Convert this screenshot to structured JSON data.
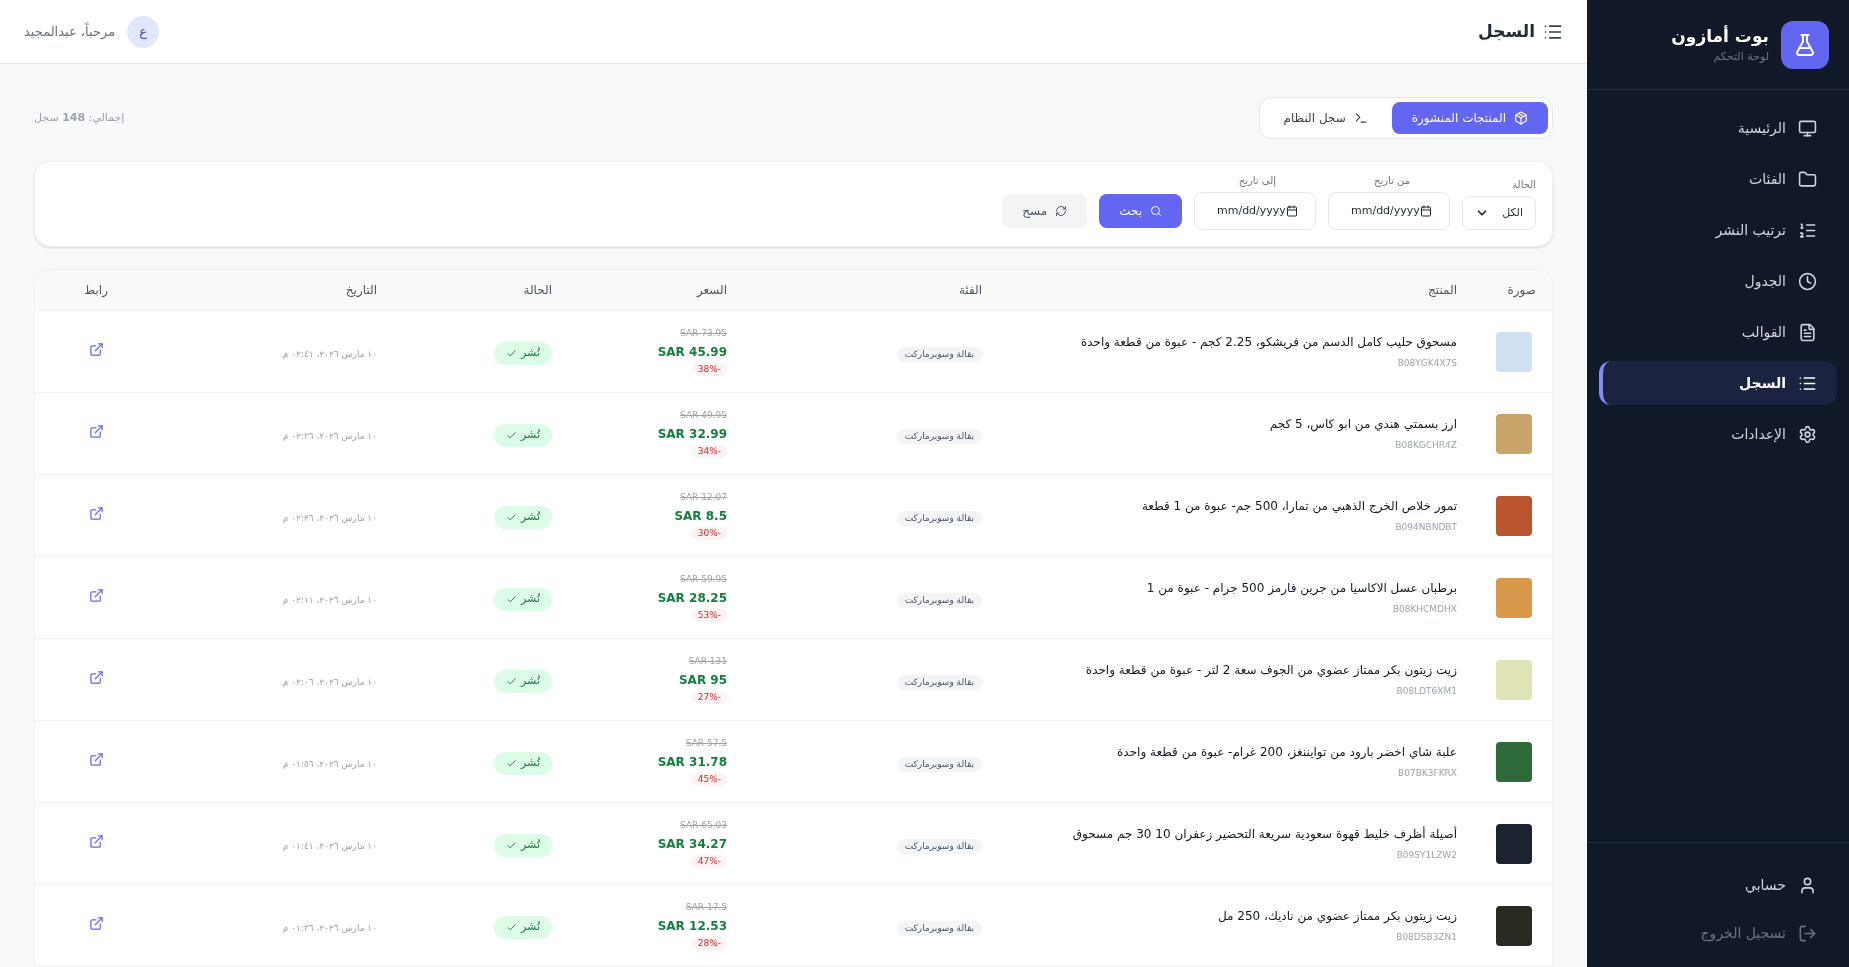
{
  "sidebar": {
    "brand": {
      "title": "بوت أمازون",
      "subtitle": "لوحة التحكم"
    },
    "items": [
      {
        "label": "الرئيسية",
        "selected": false
      },
      {
        "label": "الفئات",
        "selected": false
      },
      {
        "label": "ترتيب النشر",
        "selected": false
      },
      {
        "label": "الجدول",
        "selected": false
      },
      {
        "label": "القوالب",
        "selected": false
      },
      {
        "label": "السجل",
        "selected": true
      },
      {
        "label": "الإعدادات",
        "selected": false
      }
    ],
    "footer_items": [
      {
        "label": "حسابي"
      },
      {
        "label": "تسجيل الخروج"
      }
    ]
  },
  "header": {
    "title": "السجل",
    "avatar_initial": "ع",
    "greeting": "مرحباً، عبدالمجيد"
  },
  "tabs": [
    {
      "label": "المنتجات المنشورة",
      "selected": true
    },
    {
      "label": "سجل النظام",
      "selected": false
    }
  ],
  "total": "إجمالي: **148** سجل",
  "filters": {
    "status": {
      "label": "الحالة",
      "value": "الكل"
    },
    "from_date": {
      "label": "من تاريخ",
      "placeholder": "mm/dd/yyyy"
    },
    "to_date": {
      "label": "إلى تاريخ",
      "placeholder": "mm/dd/yyyy"
    },
    "search_button": "بحث",
    "reset_button": "مسح"
  },
  "table": {
    "columns": [
      "صورة",
      "المنتج",
      "الفئة",
      "السعر",
      "الحالة",
      "التاريخ",
      "رابط"
    ],
    "rows": [
      {
        "product": "مسحوق حليب كامل الدسم من فريشكو، 2.25 كجم - عبوة من قطعة واحدة",
        "asin": "B08YGK4X7S",
        "category": "بقالة وسوبرماركت",
        "old_price": "SAR 73.95",
        "price": "SAR 45.99",
        "discount": "38%-",
        "status": "نُشر",
        "date": "١٠ مارس ٢٠٢٦، ٠٢:٤١ م"
      },
      {
        "product": "ارز بسمتي هندي من ابو كاس، 5 كجم",
        "asin": "B08KGCHR4Z",
        "category": "بقالة وسوبرماركت",
        "old_price": "SAR 49.95",
        "price": "SAR 32.99",
        "discount": "34%-",
        "status": "نُشر",
        "date": "١٠ مارس ٢٠٢٦، ٠٢:٣٦ م"
      },
      {
        "product": "تمور خلاص الخرج الذهبي من تمارا، 500 جم- عبوة من 1 قطعة",
        "asin": "B094NBNDBT",
        "category": "بقالة وسوبرماركت",
        "old_price": "SAR 12.07",
        "price": "SAR 8.5",
        "discount": "30%-",
        "status": "نُشر",
        "date": "١٠ مارس ٢٠٢٦، ٠٢:٢٦ م"
      },
      {
        "product": "برطبان عسل الاكاسيا من جرين فارمز 500 جرام - عبوة من 1",
        "asin": "B08KHCMDHX",
        "category": "بقالة وسوبرماركت",
        "old_price": "SAR 59.95",
        "price": "SAR 28.25",
        "discount": "53%-",
        "status": "نُشر",
        "date": "١٠ مارس ٢٠٢٦، ٠٢:١١ م"
      },
      {
        "product": "زيت زيتون بكر ممتاز عضوي من الجوف سعة 2 لتر - عبوة من قطعة واحدة",
        "asin": "B08LDT6XM1",
        "category": "بقالة وسوبرماركت",
        "old_price": "SAR 131",
        "price": "SAR 95",
        "discount": "27%-",
        "status": "نُشر",
        "date": "١٠ مارس ٢٠٢٦، ٠٢:٠٦ م"
      },
      {
        "product": "علبة شاي اخضر بارود من توايننغز، 200 غرام- عبوة من قطعة واحدة",
        "asin": "B07BK3FKRX",
        "category": "بقالة وسوبرماركت",
        "old_price": "SAR 57.5",
        "price": "SAR 31.78",
        "discount": "45%-",
        "status": "نُشر",
        "date": "١٠ مارس ٢٠٢٦، ٠١:٥٦ م"
      },
      {
        "product": "أصيلة أظرف خليط قهوة سعودية سريعة التحضير زعفران 10 30 جم مسحوق",
        "asin": "B09SY1LZW2",
        "category": "بقالة وسوبرماركت",
        "old_price": "SAR 65.03",
        "price": "SAR 34.27",
        "discount": "47%-",
        "status": "نُشر",
        "date": "١٠ مارس ٢٠٢٦، ٠١:٤١ م"
      },
      {
        "product": "زيت زيتون بكر ممتاز عضوي من ناديك، 250 مل",
        "asin": "B08DSB3ZN1",
        "category": "بقالة وسوبرماركت",
        "old_price": "SAR 17.5",
        "price": "SAR 12.53",
        "discount": "28%-",
        "status": "نُشر",
        "date": "١٠ مارس ٢٠٢٦، ٠١:٣٦ م"
      }
    ]
  }
}
